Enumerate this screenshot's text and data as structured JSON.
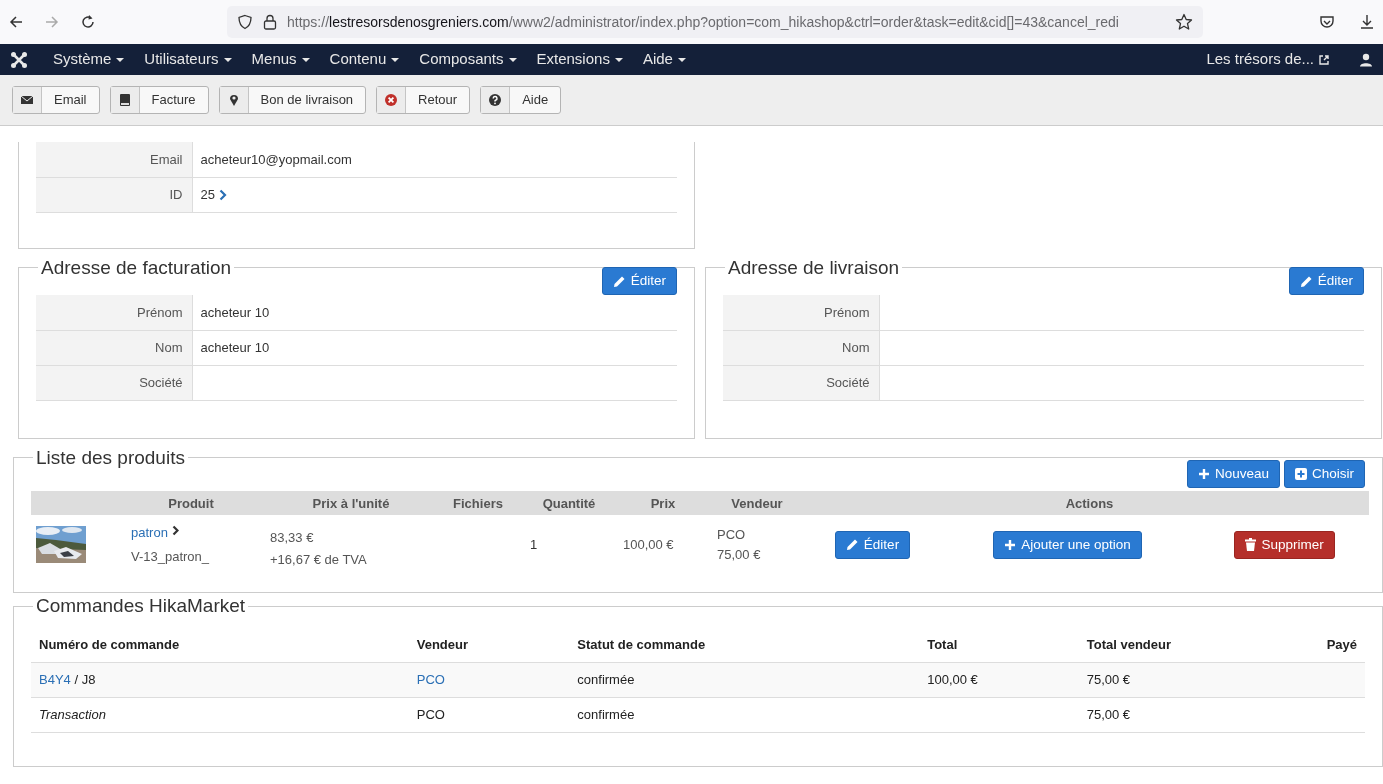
{
  "browser": {
    "url": {
      "scheme": "https://",
      "host": "lestresorsdenosgreniers.com",
      "path": "/www2/administrator/index.php?option=com_hikashop&ctrl=order&task=edit&cid[]=43&cancel_redi"
    },
    "forward_disabled": true
  },
  "navbar": {
    "menus": [
      "Système",
      "Utilisateurs",
      "Menus",
      "Contenu",
      "Composants",
      "Extensions",
      "Aide"
    ],
    "site_link": "Les trésors de..."
  },
  "toolbar": [
    {
      "label": "Email",
      "kind": "email"
    },
    {
      "label": "Facture",
      "kind": "invoice"
    },
    {
      "label": "Bon de livraison",
      "kind": "shipping"
    },
    {
      "label": "Retour",
      "kind": "cancel"
    },
    {
      "label": "Aide",
      "kind": "help"
    }
  ],
  "customer": {
    "rows": [
      {
        "label": "Email",
        "value": "acheteur10@yopmail.com"
      },
      {
        "label": "ID",
        "value": "25",
        "link": true
      }
    ]
  },
  "addresses": [
    {
      "title": "Adresse de facturation",
      "edit_button": "Éditer",
      "rows": [
        {
          "label": "Prénom",
          "value": "acheteur 10"
        },
        {
          "label": "Nom",
          "value": "acheteur 10"
        },
        {
          "label": "Société"
        }
      ]
    },
    {
      "title": "Adresse de livraison",
      "edit_button": "Éditer",
      "rows": [
        {
          "label": "Prénom"
        },
        {
          "label": "Nom"
        },
        {
          "label": "Société"
        }
      ]
    }
  ],
  "products": {
    "title": "Liste des produits",
    "buttons": [
      {
        "label": "Nouveau",
        "kind": "new"
      },
      {
        "label": "Choisir",
        "kind": "choose"
      }
    ],
    "columns": [
      "Produit",
      "Prix à l'unité",
      "Fichiers",
      "Quantité",
      "Prix",
      "Vendeur",
      "Actions"
    ],
    "rows": [
      {
        "name": "patron",
        "code": "V-13_patron_",
        "unit_price": "83,33 €",
        "tax": "+16,67 € de TVA",
        "quantity": "1",
        "price": "100,00 €",
        "vendor": "PCO",
        "vendor_amount": "75,00 €",
        "actions": [
          {
            "label": "Éditer",
            "kind": "edit"
          },
          {
            "label": "Ajouter une option",
            "kind": "add"
          },
          {
            "label": "Supprimer",
            "kind": "delete"
          }
        ]
      }
    ]
  },
  "market_orders": {
    "title": "Commandes HikaMarket",
    "columns": [
      "Numéro de commande",
      "Vendeur",
      "Statut de commande",
      "Total",
      "Total vendeur",
      "Payé"
    ],
    "rows": [
      {
        "kind": "order",
        "number": "B4Y4",
        "sub": " / J8",
        "vendor": "PCO",
        "status": "confirmée",
        "total": "100,00 €",
        "vendor_total": "75,00 €"
      },
      {
        "kind": "transaction",
        "number": "Transaction",
        "vendor": "PCO",
        "status": "confirmée",
        "vendor_total": "75,00 €"
      }
    ]
  }
}
